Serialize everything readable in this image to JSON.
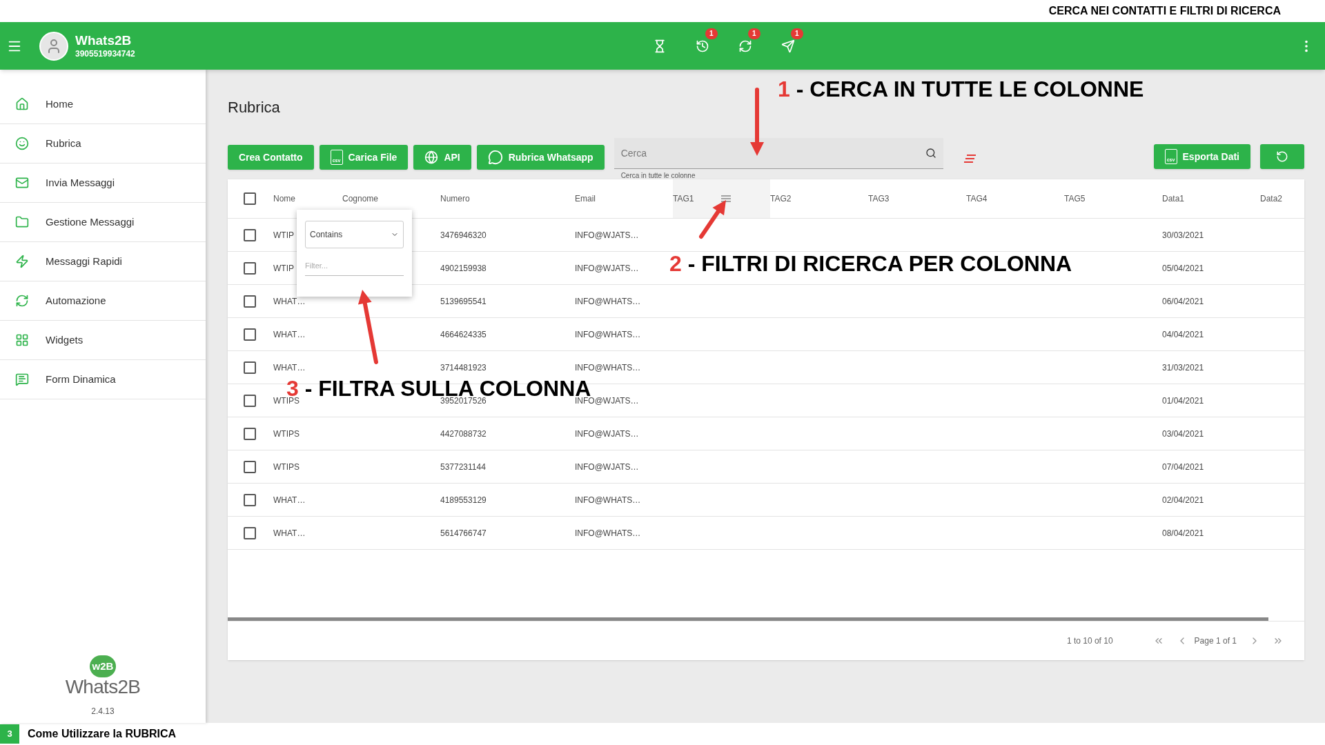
{
  "page_heading": "CERCA NEI CONTATTI E FILTRI DI RICERCA",
  "app_bar": {
    "app_name": "Whats2B",
    "phone": "3905519934742",
    "actions": [
      {
        "kind": "hourglass"
      },
      {
        "kind": "history",
        "badge": "1"
      },
      {
        "kind": "sync",
        "badge": "1"
      },
      {
        "kind": "send",
        "badge": "1"
      }
    ]
  },
  "sidebar": {
    "items": [
      {
        "label": "Home",
        "kind": "home"
      },
      {
        "label": "Rubrica",
        "kind": "contacts"
      },
      {
        "label": "Invia Messaggi",
        "kind": "mail"
      },
      {
        "label": "Gestione Messaggi",
        "kind": "folder"
      },
      {
        "label": "Messaggi Rapidi",
        "kind": "bolt"
      },
      {
        "label": "Automazione",
        "kind": "sync"
      },
      {
        "label": "Widgets",
        "kind": "widgets"
      },
      {
        "label": "Form Dinamica",
        "kind": "form"
      }
    ],
    "logo": {
      "mark": "w2B",
      "wordmark": "Whats2B"
    },
    "version": "2.4.13"
  },
  "page": {
    "title": "Rubrica",
    "buttons": [
      {
        "label": "Crea Contatto",
        "kind": "plain"
      },
      {
        "label": "Carica File",
        "kind": "csv",
        "icon_text": "csv"
      },
      {
        "label": "API",
        "kind": "globe"
      },
      {
        "label": "Rubrica Whatsapp",
        "kind": "whatsapp"
      }
    ],
    "search": {
      "placeholder": "Cerca",
      "helper": "Cerca in tutte le colonne"
    },
    "export_button": {
      "label": "Esporta Dati",
      "icon_text": "csv"
    }
  },
  "table": {
    "header_checked": false,
    "columns": [
      {
        "label": "Nome",
        "active": false
      },
      {
        "label": "Cognome",
        "active": false
      },
      {
        "label": "Numero",
        "active": false
      },
      {
        "label": "Email",
        "active": false
      },
      {
        "label": "TAG1",
        "active": true
      },
      {
        "label": "TAG2",
        "active": false
      },
      {
        "label": "TAG3",
        "active": false
      },
      {
        "label": "TAG4",
        "active": false
      },
      {
        "label": "TAG5",
        "active": false
      },
      {
        "label": "Data1",
        "active": false
      },
      {
        "label": "Data2",
        "active": false
      }
    ],
    "rows": [
      {
        "checked": false,
        "nome": "WTIP",
        "numero": "3476946320",
        "email": "INFO@WJATS…",
        "data1": "30/03/2021"
      },
      {
        "checked": false,
        "nome": "WTIP",
        "numero": "4902159938",
        "email": "INFO@WJATS…",
        "data1": "05/04/2021"
      },
      {
        "checked": false,
        "nome": "WHAT…",
        "numero": "5139695541",
        "email": "INFO@WHATS…",
        "data1": "06/04/2021"
      },
      {
        "checked": false,
        "nome": "WHAT…",
        "numero": "4664624335",
        "email": "INFO@WHATS…",
        "data1": "04/04/2021"
      },
      {
        "checked": false,
        "nome": "WHAT…",
        "numero": "3714481923",
        "email": "INFO@WHATS…",
        "data1": "31/03/2021"
      },
      {
        "checked": false,
        "nome": "WTIPS",
        "numero": "3952017526",
        "email": "INFO@WJATS…",
        "data1": "01/04/2021"
      },
      {
        "checked": false,
        "nome": "WTIPS",
        "numero": "4427088732",
        "email": "INFO@WJATS…",
        "data1": "03/04/2021"
      },
      {
        "checked": false,
        "nome": "WTIPS",
        "numero": "5377231144",
        "email": "INFO@WJATS…",
        "data1": "07/04/2021"
      },
      {
        "checked": false,
        "nome": "WHAT…",
        "numero": "4189553129",
        "email": "INFO@WHATS…",
        "data1": "02/04/2021"
      },
      {
        "checked": false,
        "nome": "WHAT…",
        "numero": "5614766747",
        "email": "INFO@WHATS…",
        "data1": "08/04/2021"
      }
    ],
    "filter_popup": {
      "operator": "Contains",
      "placeholder": "Filter..."
    },
    "pagination": {
      "range": "1 to 10 of 10",
      "page": "Page 1 of 1"
    }
  },
  "annotations": [
    {
      "number": "1",
      "text": "- CERCA IN TUTTE LE COLONNE"
    },
    {
      "number": "2",
      "text": "- FILTRI DI RICERCA PER COLONNA"
    },
    {
      "number": "3",
      "text": "- FILTRA SULLA COLONNA"
    }
  ],
  "footer": {
    "step": "3",
    "caption": "Come Utilizzare la RUBRICA"
  }
}
